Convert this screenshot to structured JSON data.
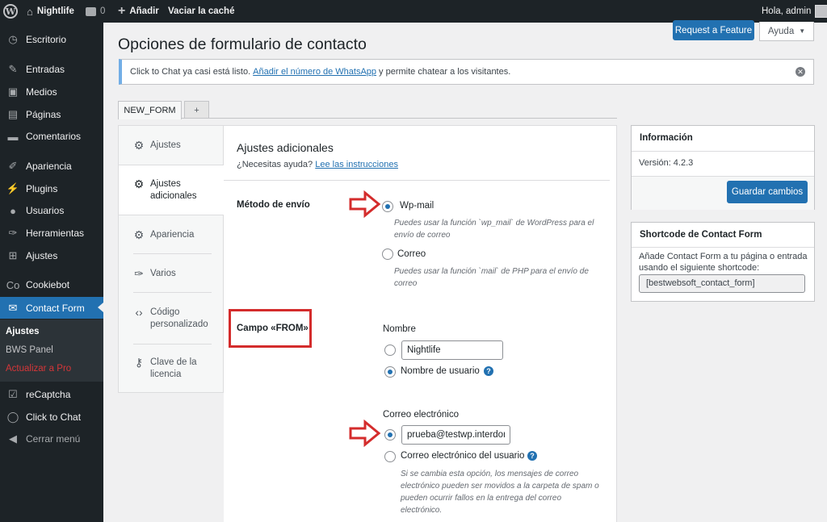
{
  "adminbar": {
    "site_name": "Nightlife",
    "comments_count": "0",
    "new_label": "Añadir",
    "cache_label": "Vaciar la caché",
    "greeting": "Hola, admin"
  },
  "sidebar": {
    "items": [
      {
        "label": "Escritorio",
        "icon": "dashboard-icon"
      },
      {
        "label": "Entradas",
        "icon": "pin-icon"
      },
      {
        "label": "Medios",
        "icon": "media-icon"
      },
      {
        "label": "Páginas",
        "icon": "pages-icon"
      },
      {
        "label": "Comentarios",
        "icon": "comments-icon"
      },
      {
        "label": "Apariencia",
        "icon": "brush-icon"
      },
      {
        "label": "Plugins",
        "icon": "plugin-icon"
      },
      {
        "label": "Usuarios",
        "icon": "user-icon"
      },
      {
        "label": "Herramientas",
        "icon": "wrench-icon"
      },
      {
        "label": "Ajustes",
        "icon": "settings-icon"
      },
      {
        "label": "Cookiebot",
        "icon": "cookiebot-icon"
      },
      {
        "label": "Contact Form",
        "icon": "mail-icon"
      },
      {
        "label": "reCaptcha",
        "icon": "check-icon"
      },
      {
        "label": "Click to Chat",
        "icon": "whatsapp-icon"
      },
      {
        "label": "Cerrar menú",
        "icon": "collapse-icon"
      }
    ],
    "submenu": [
      {
        "label": "Ajustes"
      },
      {
        "label": "BWS Panel"
      },
      {
        "label": "Actualizar a Pro"
      }
    ]
  },
  "header": {
    "title": "Opciones de formulario de contacto",
    "feature_button": "Request a Feature",
    "help_button": "Ayuda"
  },
  "notice": {
    "text_before": "Click to Chat ya casi está listo.",
    "link": "Añadir el número de WhatsApp",
    "text_after": "y permite chatear a los visitantes."
  },
  "tabs": [
    {
      "label": "NEW_FORM"
    },
    {
      "label": "+"
    }
  ],
  "nav": [
    {
      "label": "Ajustes",
      "icon": "gear-icon"
    },
    {
      "label": "Ajustes adicionales",
      "icon": "gear-icon"
    },
    {
      "label": "Apariencia",
      "icon": "gear-icon"
    },
    {
      "label": "Varios",
      "icon": "wrench-icon"
    },
    {
      "label": "Código personalizado",
      "icon": "code-icon"
    },
    {
      "label": "Clave de la licencia",
      "icon": "key-icon"
    }
  ],
  "content": {
    "section_title": "Ajustes adicionales",
    "help_text": "¿Necesitas ayuda?",
    "help_link": "Lee las instrucciones",
    "send_method": {
      "label": "Método de envío",
      "options": [
        {
          "label": "Wp-mail",
          "desc": "Puedes usar la función `wp_mail` de WordPress para el envío de correo",
          "checked": true
        },
        {
          "label": "Correo",
          "desc": "Puedes usar la función `mail` de PHP para el envío de correo",
          "checked": false
        }
      ]
    },
    "from_field": {
      "label": "Campo «FROM»",
      "name_heading": "Nombre",
      "name_value": "Nightlife",
      "name_user_option": "Nombre de usuario",
      "email_heading": "Correo electrónico",
      "email_value": "prueba@testwp.interdominios.com",
      "email_user_option": "Correo electrónico del usuario",
      "email_desc": "Si se cambia esta opción, los mensajes de correo electrónico pueden ser movidos a la carpeta de spam o pueden ocurrir fallos en la entrega del correo electrónico."
    }
  },
  "info_box": {
    "title": "Información",
    "version": "Versión: 4.2.3",
    "save_button": "Guardar cambios"
  },
  "shortcode_box": {
    "title": "Shortcode de Contact Form",
    "text": "Añade Contact Form a tu página o entrada usando el siguiente shortcode:",
    "shortcode": "[bestwebsoft_contact_form]"
  },
  "colors": {
    "accent": "#2271b1",
    "sidebar_bg": "#1d2327",
    "annotation_red": "#d42c2c",
    "upgrade_text": "#d63638"
  }
}
